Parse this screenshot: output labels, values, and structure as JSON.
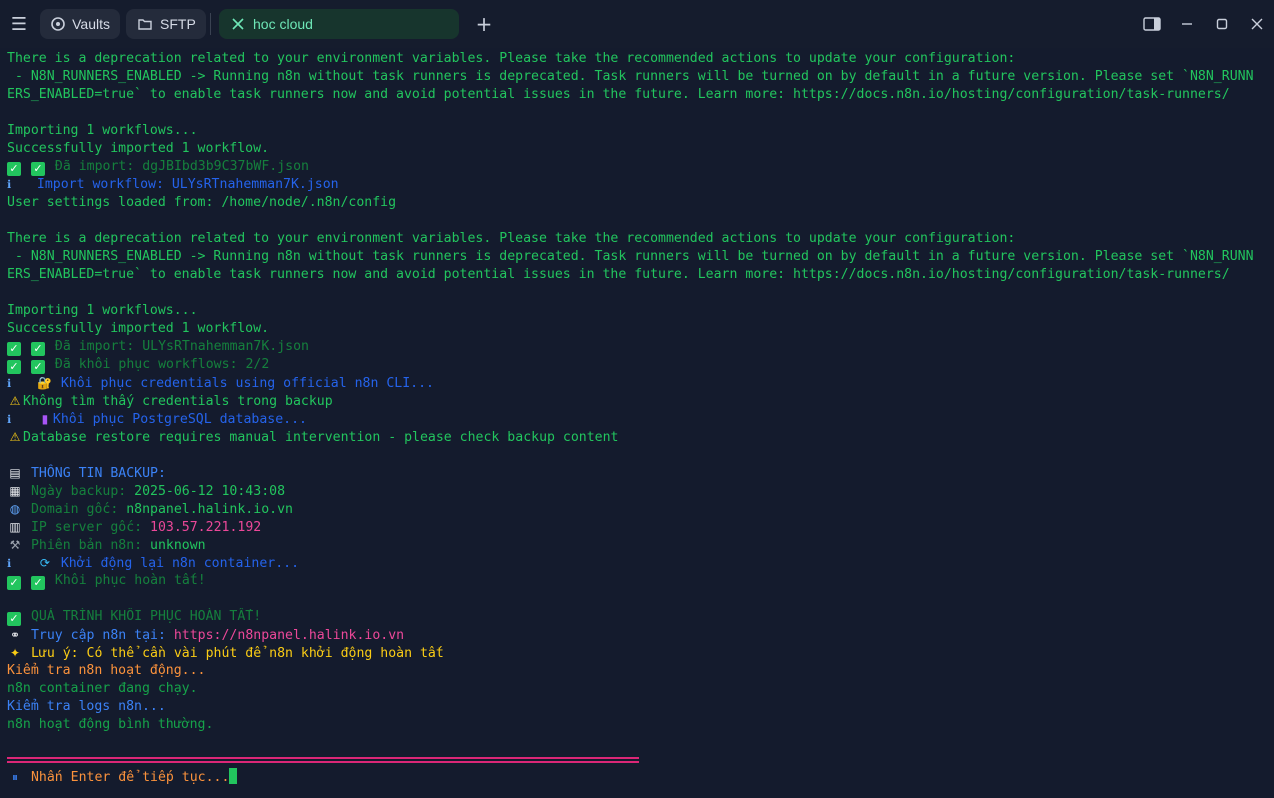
{
  "tabs": {
    "vaults": "Vaults",
    "sftp": "SFTP",
    "active": "hoc cloud"
  },
  "icons": {
    "menu": "hamburger-menu-icon",
    "vaults": "vault-icon",
    "sftp": "folder-icon",
    "active": "close-icon",
    "new_tab": "plus-icon",
    "split": "split-view-icon",
    "minimize": "minimize-icon",
    "maximize": "maximize-icon",
    "close": "close-window-icon"
  },
  "colors": {
    "background": "#141b2d",
    "green": "#22c55e",
    "blue": "#3b82f6",
    "orange": "#fb923c",
    "pink": "#ec4899",
    "active_tab": "#17352d"
  },
  "terminal": {
    "deprecation_1a": "There is a deprecation related to your environment variables. Please take the recommended actions to update your configuration:",
    "deprecation_1b": " - N8N_RUNNERS_ENABLED -> Running n8n without task runners is deprecated. Task runners will be turned on by default in a future version. Please set `N8N_RUNN",
    "deprecation_1c": "ERS_ENABLED=true` to enable task runners now and avoid potential issues in the future. Learn more: https://docs.n8n.io/hosting/configuration/task-runners/",
    "importing_1": "Importing 1 workflows...",
    "success_1": "Successfully imported 1 workflow.",
    "imported_1": " Đã import: dgJBIbd3b9C37bWF.json",
    "import_workflow": "Import workflow: ULYsRTnahemman7K.json",
    "user_settings": "User settings loaded from: /home/node/.n8n/config",
    "deprecation_2a": "There is a deprecation related to your environment variables. Please take the recommended actions to update your configuration:",
    "deprecation_2b": " - N8N_RUNNERS_ENABLED -> Running n8n without task runners is deprecated. Task runners will be turned on by default in a future version. Please set `N8N_RUNN",
    "deprecation_2c": "ERS_ENABLED=true` to enable task runners now and avoid potential issues in the future. Learn more: https://docs.n8n.io/hosting/configuration/task-runners/",
    "importing_2": "Importing 1 workflows...",
    "success_2": "Successfully imported 1 workflow.",
    "imported_2": " Đã import: ULYsRTnahemman7K.json",
    "restored_workflows": " Đã khôi phục workflows: 2/2",
    "restore_credentials": " Khôi phục credentials using official n8n CLI...",
    "no_credentials": "Không tìm thấy credentials trong backup",
    "restore_postgres": "Khôi phục PostgreSQL database...",
    "db_manual": "Database restore requires manual intervention - please check backup content",
    "backup_info_title": " THÔNG TIN BACKUP:",
    "backup_date_label": " Ngày backup: ",
    "backup_date_value": "2025-06-12 10:43:08",
    "domain_label": " Domain gốc: ",
    "domain_value": "n8npanel.halink.io.vn",
    "ip_label": " IP server gốc: ",
    "ip_value": "103.57.221.192",
    "version_label": " Phiên bản n8n: ",
    "version_value": "unknown",
    "restart": " Khởi động lại n8n container...",
    "restore_done": " Khôi phục hoàn tất!",
    "process_done": " QUÁ TRÌNH KHÔI PHỤC HOÀN TẤT!",
    "access_label": " Truy cập n8n tại: ",
    "access_url": "https://n8npanel.halink.io.vn",
    "note": " Lưu ý: Có thể cần vài phút để n8n khởi động hoàn tất",
    "check_active": "Kiểm tra n8n hoạt động...",
    "container_running": "n8n container đang chạy.",
    "check_logs": "Kiểm tra logs n8n...",
    "normal": "n8n hoạt động bình thường.",
    "prompt": " Nhấn Enter để tiếp tục..."
  }
}
